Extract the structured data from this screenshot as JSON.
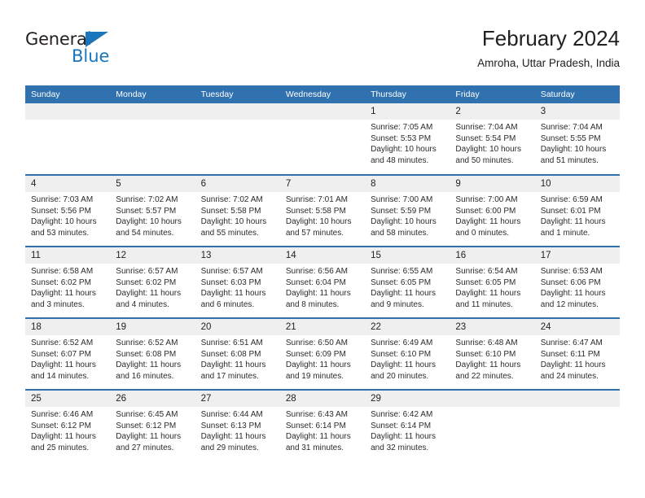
{
  "brand": {
    "name_dark": "General",
    "name_blue": "Blue",
    "accent_color": "#1b75bb"
  },
  "header": {
    "title": "February 2024",
    "location": "Amroha, Uttar Pradesh, India"
  },
  "theme": {
    "header_row_bg": "#3071b0",
    "daynum_bg": "#efefef",
    "text_color": "#2b2b2b"
  },
  "weekdays": [
    "Sunday",
    "Monday",
    "Tuesday",
    "Wednesday",
    "Thursday",
    "Friday",
    "Saturday"
  ],
  "weeks": [
    [
      {
        "day": "",
        "blank": true
      },
      {
        "day": "",
        "blank": true
      },
      {
        "day": "",
        "blank": true
      },
      {
        "day": "",
        "blank": true
      },
      {
        "day": "1",
        "sunrise": "Sunrise: 7:05 AM",
        "sunset": "Sunset: 5:53 PM",
        "daylight_1": "Daylight: 10 hours",
        "daylight_2": "and 48 minutes."
      },
      {
        "day": "2",
        "sunrise": "Sunrise: 7:04 AM",
        "sunset": "Sunset: 5:54 PM",
        "daylight_1": "Daylight: 10 hours",
        "daylight_2": "and 50 minutes."
      },
      {
        "day": "3",
        "sunrise": "Sunrise: 7:04 AM",
        "sunset": "Sunset: 5:55 PM",
        "daylight_1": "Daylight: 10 hours",
        "daylight_2": "and 51 minutes."
      }
    ],
    [
      {
        "day": "4",
        "sunrise": "Sunrise: 7:03 AM",
        "sunset": "Sunset: 5:56 PM",
        "daylight_1": "Daylight: 10 hours",
        "daylight_2": "and 53 minutes."
      },
      {
        "day": "5",
        "sunrise": "Sunrise: 7:02 AM",
        "sunset": "Sunset: 5:57 PM",
        "daylight_1": "Daylight: 10 hours",
        "daylight_2": "and 54 minutes."
      },
      {
        "day": "6",
        "sunrise": "Sunrise: 7:02 AM",
        "sunset": "Sunset: 5:58 PM",
        "daylight_1": "Daylight: 10 hours",
        "daylight_2": "and 55 minutes."
      },
      {
        "day": "7",
        "sunrise": "Sunrise: 7:01 AM",
        "sunset": "Sunset: 5:58 PM",
        "daylight_1": "Daylight: 10 hours",
        "daylight_2": "and 57 minutes."
      },
      {
        "day": "8",
        "sunrise": "Sunrise: 7:00 AM",
        "sunset": "Sunset: 5:59 PM",
        "daylight_1": "Daylight: 10 hours",
        "daylight_2": "and 58 minutes."
      },
      {
        "day": "9",
        "sunrise": "Sunrise: 7:00 AM",
        "sunset": "Sunset: 6:00 PM",
        "daylight_1": "Daylight: 11 hours",
        "daylight_2": "and 0 minutes."
      },
      {
        "day": "10",
        "sunrise": "Sunrise: 6:59 AM",
        "sunset": "Sunset: 6:01 PM",
        "daylight_1": "Daylight: 11 hours",
        "daylight_2": "and 1 minute."
      }
    ],
    [
      {
        "day": "11",
        "sunrise": "Sunrise: 6:58 AM",
        "sunset": "Sunset: 6:02 PM",
        "daylight_1": "Daylight: 11 hours",
        "daylight_2": "and 3 minutes."
      },
      {
        "day": "12",
        "sunrise": "Sunrise: 6:57 AM",
        "sunset": "Sunset: 6:02 PM",
        "daylight_1": "Daylight: 11 hours",
        "daylight_2": "and 4 minutes."
      },
      {
        "day": "13",
        "sunrise": "Sunrise: 6:57 AM",
        "sunset": "Sunset: 6:03 PM",
        "daylight_1": "Daylight: 11 hours",
        "daylight_2": "and 6 minutes."
      },
      {
        "day": "14",
        "sunrise": "Sunrise: 6:56 AM",
        "sunset": "Sunset: 6:04 PM",
        "daylight_1": "Daylight: 11 hours",
        "daylight_2": "and 8 minutes."
      },
      {
        "day": "15",
        "sunrise": "Sunrise: 6:55 AM",
        "sunset": "Sunset: 6:05 PM",
        "daylight_1": "Daylight: 11 hours",
        "daylight_2": "and 9 minutes."
      },
      {
        "day": "16",
        "sunrise": "Sunrise: 6:54 AM",
        "sunset": "Sunset: 6:05 PM",
        "daylight_1": "Daylight: 11 hours",
        "daylight_2": "and 11 minutes."
      },
      {
        "day": "17",
        "sunrise": "Sunrise: 6:53 AM",
        "sunset": "Sunset: 6:06 PM",
        "daylight_1": "Daylight: 11 hours",
        "daylight_2": "and 12 minutes."
      }
    ],
    [
      {
        "day": "18",
        "sunrise": "Sunrise: 6:52 AM",
        "sunset": "Sunset: 6:07 PM",
        "daylight_1": "Daylight: 11 hours",
        "daylight_2": "and 14 minutes."
      },
      {
        "day": "19",
        "sunrise": "Sunrise: 6:52 AM",
        "sunset": "Sunset: 6:08 PM",
        "daylight_1": "Daylight: 11 hours",
        "daylight_2": "and 16 minutes."
      },
      {
        "day": "20",
        "sunrise": "Sunrise: 6:51 AM",
        "sunset": "Sunset: 6:08 PM",
        "daylight_1": "Daylight: 11 hours",
        "daylight_2": "and 17 minutes."
      },
      {
        "day": "21",
        "sunrise": "Sunrise: 6:50 AM",
        "sunset": "Sunset: 6:09 PM",
        "daylight_1": "Daylight: 11 hours",
        "daylight_2": "and 19 minutes."
      },
      {
        "day": "22",
        "sunrise": "Sunrise: 6:49 AM",
        "sunset": "Sunset: 6:10 PM",
        "daylight_1": "Daylight: 11 hours",
        "daylight_2": "and 20 minutes."
      },
      {
        "day": "23",
        "sunrise": "Sunrise: 6:48 AM",
        "sunset": "Sunset: 6:10 PM",
        "daylight_1": "Daylight: 11 hours",
        "daylight_2": "and 22 minutes."
      },
      {
        "day": "24",
        "sunrise": "Sunrise: 6:47 AM",
        "sunset": "Sunset: 6:11 PM",
        "daylight_1": "Daylight: 11 hours",
        "daylight_2": "and 24 minutes."
      }
    ],
    [
      {
        "day": "25",
        "sunrise": "Sunrise: 6:46 AM",
        "sunset": "Sunset: 6:12 PM",
        "daylight_1": "Daylight: 11 hours",
        "daylight_2": "and 25 minutes."
      },
      {
        "day": "26",
        "sunrise": "Sunrise: 6:45 AM",
        "sunset": "Sunset: 6:12 PM",
        "daylight_1": "Daylight: 11 hours",
        "daylight_2": "and 27 minutes."
      },
      {
        "day": "27",
        "sunrise": "Sunrise: 6:44 AM",
        "sunset": "Sunset: 6:13 PM",
        "daylight_1": "Daylight: 11 hours",
        "daylight_2": "and 29 minutes."
      },
      {
        "day": "28",
        "sunrise": "Sunrise: 6:43 AM",
        "sunset": "Sunset: 6:14 PM",
        "daylight_1": "Daylight: 11 hours",
        "daylight_2": "and 31 minutes."
      },
      {
        "day": "29",
        "sunrise": "Sunrise: 6:42 AM",
        "sunset": "Sunset: 6:14 PM",
        "daylight_1": "Daylight: 11 hours",
        "daylight_2": "and 32 minutes."
      },
      {
        "day": "",
        "blank": true
      },
      {
        "day": "",
        "blank": true
      }
    ]
  ]
}
